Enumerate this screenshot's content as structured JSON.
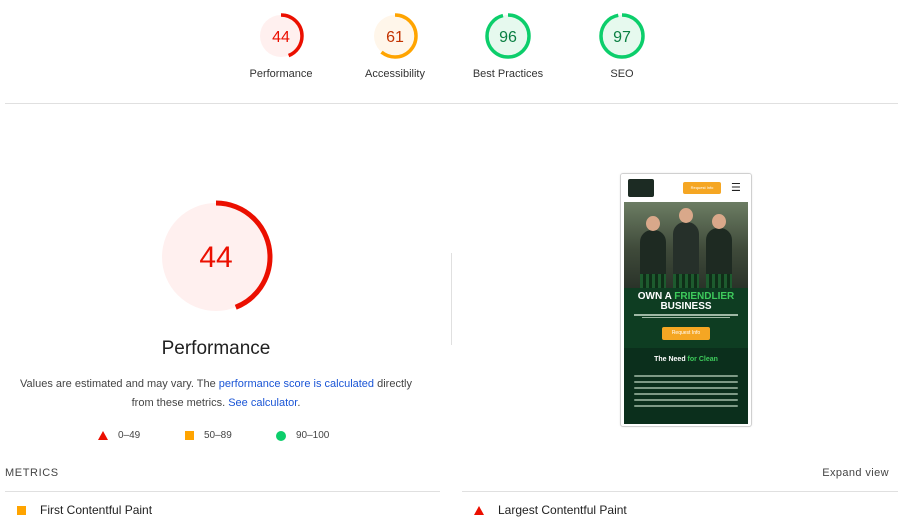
{
  "colors": {
    "fail": "#eb0f00",
    "fail_bg": "#fff0ef",
    "average": "#ffa400",
    "average_bg": "#fff6ea",
    "pass": "#0cce6b",
    "pass_bg": "#e6f9ee",
    "link": "#1a55d6"
  },
  "categories": [
    {
      "score": 44,
      "label": "Performance",
      "rating": "fail"
    },
    {
      "score": 61,
      "label": "Accessibility",
      "rating": "average"
    },
    {
      "score": 96,
      "label": "Best Practices",
      "rating": "pass"
    },
    {
      "score": 97,
      "label": "SEO",
      "rating": "pass"
    }
  ],
  "performance": {
    "score": 44,
    "title": "Performance",
    "desc_text_1": "Values are estimated and may vary. The ",
    "desc_link_1": "performance score is calculated",
    "desc_text_2": " directly from these metrics. ",
    "desc_link_2": "See calculator",
    "desc_text_3": "."
  },
  "legend": [
    {
      "icon": "triangle-icon",
      "range": "0–49"
    },
    {
      "icon": "square-icon",
      "range": "50–89"
    },
    {
      "icon": "circle-icon",
      "range": "90–100"
    }
  ],
  "screenshot": {
    "top_button": "Request Info",
    "headline_1": "OWN A ",
    "headline_green": "FRIENDLIER",
    "headline_2": "BUSINESS",
    "hero_button": "Request Info",
    "section_title_1": "The Need ",
    "section_title_green": "for Clean"
  },
  "metrics": {
    "section_label": "METRICS",
    "expand_label": "Expand view",
    "items": [
      {
        "name": "First Contentful Paint",
        "rating": "average"
      },
      {
        "name": "Largest Contentful Paint",
        "rating": "fail"
      }
    ]
  }
}
